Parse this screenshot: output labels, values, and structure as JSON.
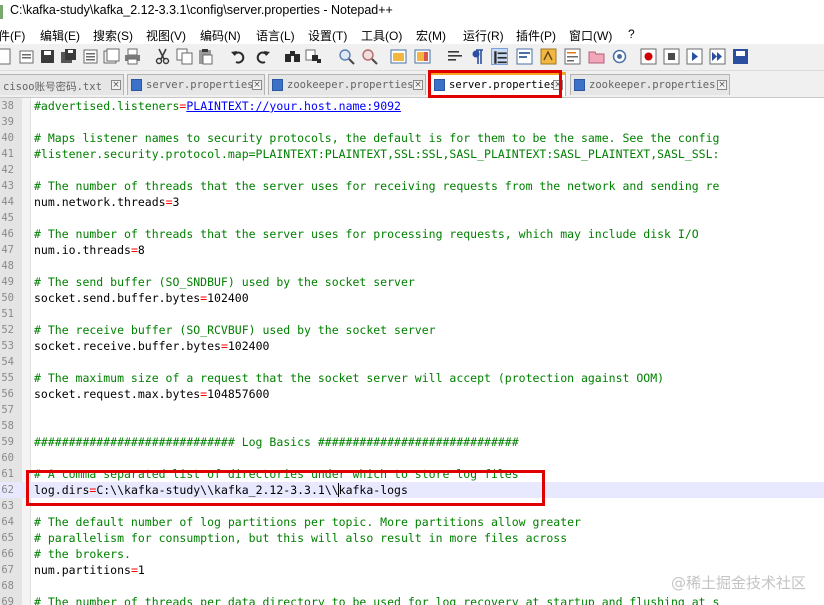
{
  "window": {
    "title": "C:\\kafka-study\\kafka_2.12-3.3.1\\config\\server.properties - Notepad++"
  },
  "menu": [
    {
      "label": "件(F)"
    },
    {
      "label": "编辑(E)"
    },
    {
      "label": "搜索(S)"
    },
    {
      "label": "视图(V)"
    },
    {
      "label": "编码(N)"
    },
    {
      "label": "语言(L)"
    },
    {
      "label": "设置(T)"
    },
    {
      "label": "工具(O)"
    },
    {
      "label": "宏(M)"
    },
    {
      "label": "运行(R)"
    },
    {
      "label": "插件(P)"
    },
    {
      "label": "窗口(W)"
    },
    {
      "label": "?"
    }
  ],
  "toolbar": [
    {
      "icon": "new-file-icon"
    },
    {
      "icon": "open-file-icon"
    },
    {
      "icon": "save-icon"
    },
    {
      "icon": "save-all-icon"
    },
    {
      "icon": "close-icon"
    },
    {
      "icon": "close-all-icon"
    },
    {
      "icon": "print-icon"
    },
    {
      "icon": "cut-icon"
    },
    {
      "icon": "copy-icon"
    },
    {
      "icon": "paste-icon"
    },
    {
      "icon": "undo-icon"
    },
    {
      "icon": "redo-icon"
    },
    {
      "icon": "find-icon"
    },
    {
      "icon": "replace-icon"
    },
    {
      "icon": "zoom-in-icon"
    },
    {
      "icon": "zoom-out-icon"
    },
    {
      "icon": "sync-vertical-icon"
    },
    {
      "icon": "sync-horizontal-icon"
    },
    {
      "icon": "word-wrap-icon"
    },
    {
      "icon": "show-all-chars-icon"
    },
    {
      "icon": "indent-guide-icon"
    },
    {
      "icon": "udl-icon"
    },
    {
      "icon": "doc-map-icon"
    },
    {
      "icon": "function-list-icon"
    },
    {
      "icon": "folder-workspace-icon"
    },
    {
      "icon": "monitor-icon"
    },
    {
      "icon": "record-macro-icon"
    },
    {
      "icon": "stop-record-icon"
    },
    {
      "icon": "play-macro-icon"
    },
    {
      "icon": "run-macro-multiple-icon"
    },
    {
      "icon": "save-macro-icon"
    }
  ],
  "tabs": [
    {
      "label": "cisoo账号密码.txt"
    },
    {
      "label": "server.properties"
    },
    {
      "label": "zookeeper.properties"
    },
    {
      "label": "server.properties"
    },
    {
      "label": "zookeeper.properties"
    }
  ],
  "lines": [
    {
      "n": "38",
      "type": "prop-link",
      "key": "#advertised.listeners",
      "value": "PLAINTEXT://your.host.name:9092"
    },
    {
      "n": "39",
      "type": "blank"
    },
    {
      "n": "40",
      "type": "comment",
      "text": "# Maps listener names to security protocols, the default is for them to be the same. See the config"
    },
    {
      "n": "41",
      "type": "comment",
      "text": "#listener.security.protocol.map=PLAINTEXT:PLAINTEXT,SSL:SSL,SASL_PLAINTEXT:SASL_PLAINTEXT,SASL_SSL:"
    },
    {
      "n": "42",
      "type": "blank"
    },
    {
      "n": "43",
      "type": "comment",
      "text": "# The number of threads that the server uses for receiving requests from the network and sending re"
    },
    {
      "n": "44",
      "type": "prop",
      "key": "num.network.threads",
      "value": "3"
    },
    {
      "n": "45",
      "type": "blank"
    },
    {
      "n": "46",
      "type": "comment",
      "text": "# The number of threads that the server uses for processing requests, which may include disk I/O"
    },
    {
      "n": "47",
      "type": "prop",
      "key": "num.io.threads",
      "value": "8"
    },
    {
      "n": "48",
      "type": "blank"
    },
    {
      "n": "49",
      "type": "comment",
      "text": "# The send buffer (SO_SNDBUF) used by the socket server"
    },
    {
      "n": "50",
      "type": "prop",
      "key": "socket.send.buffer.bytes",
      "value": "102400"
    },
    {
      "n": "51",
      "type": "blank"
    },
    {
      "n": "52",
      "type": "comment",
      "text": "# The receive buffer (SO_RCVBUF) used by the socket server"
    },
    {
      "n": "53",
      "type": "prop",
      "key": "socket.receive.buffer.bytes",
      "value": "102400"
    },
    {
      "n": "54",
      "type": "blank"
    },
    {
      "n": "55",
      "type": "comment",
      "text": "# The maximum size of a request that the socket server will accept (protection against OOM)"
    },
    {
      "n": "56",
      "type": "prop",
      "key": "socket.request.max.bytes",
      "value": "104857600"
    },
    {
      "n": "57",
      "type": "blank"
    },
    {
      "n": "58",
      "type": "blank"
    },
    {
      "n": "59",
      "type": "comment",
      "text": "############################# Log Basics #############################"
    },
    {
      "n": "60",
      "type": "blank"
    },
    {
      "n": "61",
      "type": "comment",
      "text": "# A comma separated list of directories under which to store log files"
    },
    {
      "n": "62",
      "type": "prop-caret",
      "key": "log.dirs",
      "value_before": "C:\\\\kafka-study\\\\kafka_2.12-3.3.1\\\\",
      "value_after": "kafka-logs"
    },
    {
      "n": "63",
      "type": "blank"
    },
    {
      "n": "64",
      "type": "comment",
      "text": "# The default number of log partitions per topic. More partitions allow greater"
    },
    {
      "n": "65",
      "type": "comment",
      "text": "# parallelism for consumption, but this will also result in more files across"
    },
    {
      "n": "66",
      "type": "comment",
      "text": "# the brokers."
    },
    {
      "n": "67",
      "type": "prop",
      "key": "num.partitions",
      "value": "1"
    },
    {
      "n": "68",
      "type": "blank"
    },
    {
      "n": "69",
      "type": "comment",
      "text": "# The number of threads per data directory to be used for log recovery at startup and flushing at s"
    }
  ],
  "watermark": "@稀土掘金技术社区",
  "colors": {
    "comment": "#008000",
    "operator": "#ff0000",
    "link": "#0000ff",
    "current_line": "#e8e8ff",
    "annotation_box": "#e00000",
    "active_tab_accent": "#f5a623"
  }
}
